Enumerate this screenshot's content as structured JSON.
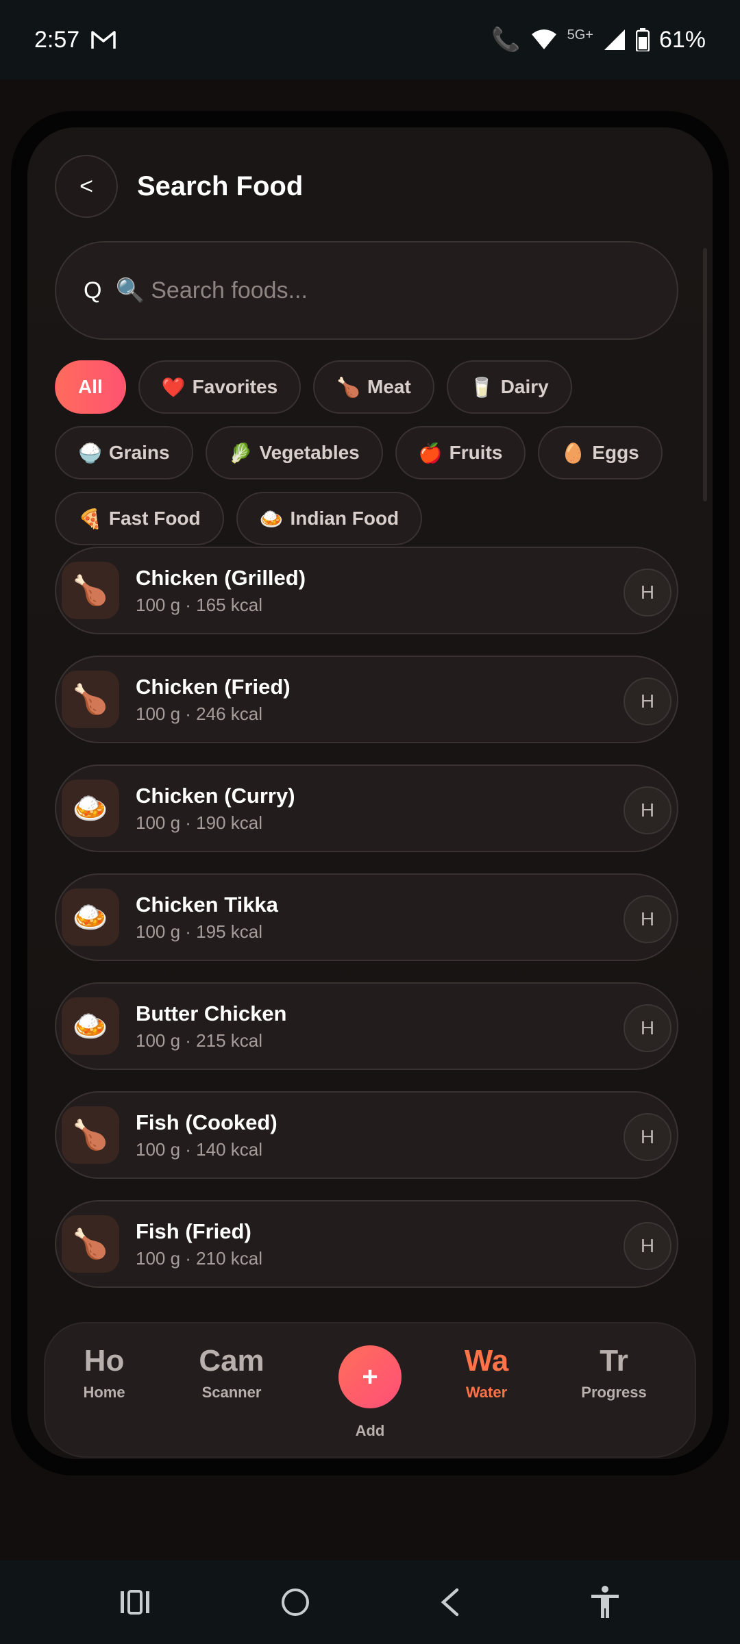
{
  "status": {
    "time": "2:57",
    "mail_icon": "gmail-icon",
    "network": "5G+",
    "battery": "61%"
  },
  "header": {
    "back_label": "<",
    "title": "Search Food"
  },
  "search": {
    "prefix": "Q",
    "placeholder": "🔍 Search foods..."
  },
  "categories": {
    "row1": [
      {
        "label": "All",
        "icon": ""
      },
      {
        "label": "Favorites",
        "icon": "❤️"
      },
      {
        "label": "Meat",
        "icon": "🍗"
      },
      {
        "label": "Dairy",
        "icon": "🥛"
      }
    ],
    "row2": [
      {
        "label": "Grains",
        "icon": "🍚"
      },
      {
        "label": "Vegetables",
        "icon": "🥬"
      },
      {
        "label": "Fruits",
        "icon": "🍎"
      },
      {
        "label": "Eggs",
        "icon": "🥚"
      }
    ],
    "row3": [
      {
        "label": "Fast Food",
        "icon": "🍕"
      },
      {
        "label": "Indian Food",
        "icon": "🍛"
      }
    ]
  },
  "foods": [
    {
      "name": "Chicken (Grilled)",
      "meta": "100 g · 165 kcal",
      "icon": "🍗",
      "action": "H"
    },
    {
      "name": "Chicken (Fried)",
      "meta": "100 g · 246 kcal",
      "icon": "🍗",
      "action": "H"
    },
    {
      "name": "Chicken (Curry)",
      "meta": "100 g · 190 kcal",
      "icon": "🍛",
      "action": "H"
    },
    {
      "name": "Chicken Tikka",
      "meta": "100 g · 195 kcal",
      "icon": "🍛",
      "action": "H"
    },
    {
      "name": "Butter Chicken",
      "meta": "100 g · 215 kcal",
      "icon": "🍛",
      "action": "H"
    },
    {
      "name": "Fish (Cooked)",
      "meta": "100 g · 140 kcal",
      "icon": "🍗",
      "action": "H"
    },
    {
      "name": "Fish (Fried)",
      "meta": "100 g · 210 kcal",
      "icon": "🍗",
      "action": "H"
    }
  ],
  "nav": {
    "home": {
      "abbr": "Ho",
      "label": "Home"
    },
    "scanner": {
      "abbr": "Cam",
      "label": "Scanner"
    },
    "add": {
      "symbol": "+",
      "label": "Add"
    },
    "water": {
      "abbr": "Wa",
      "label": "Water"
    },
    "progress": {
      "abbr": "Tr",
      "label": "Progress"
    }
  },
  "system_nav": {
    "recents": "|||",
    "home": "○",
    "back": "<",
    "accessibility": "♿"
  },
  "colors": {
    "accent": "#ff6b5d",
    "active_nav": "#ff7349",
    "background": "#161211"
  }
}
